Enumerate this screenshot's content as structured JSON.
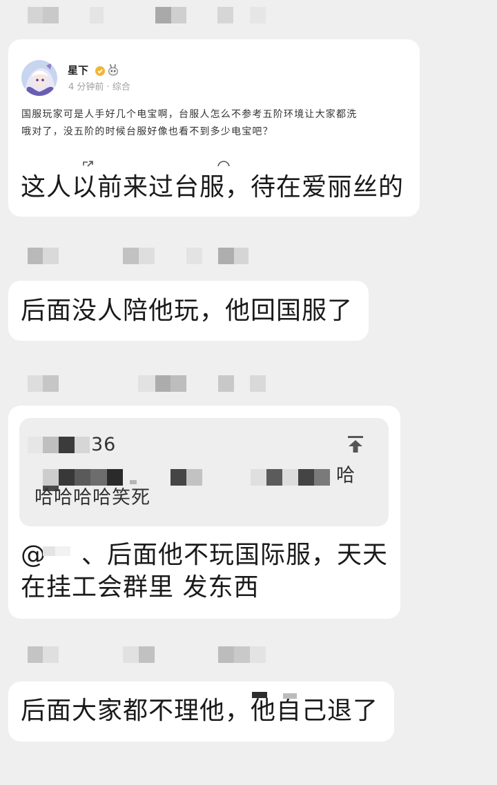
{
  "colors": {
    "background": "#efefef",
    "bubble": "#ffffff",
    "quote_background": "#eeeeee",
    "text": "#1a1a1a",
    "meta_text": "#a0a0a0",
    "badge": "#f2b632"
  },
  "messages": [
    {
      "embedded_post": {
        "author": "星下",
        "author_icons": [
          "verified-badge-icon",
          "emoji-sticker-icon"
        ],
        "meta": "4 分钟前 · 综合",
        "lines": [
          "国服玩家可是人手好几个电宝啊，台服人怎么不参考五阶环境让大家都洗",
          "哦对了，没五阶的时候台服好像也看不到多少电宝吧？"
        ],
        "action_icons": [
          "share-icon",
          "comment-icon"
        ]
      },
      "text": "这人以前来过台服，待在爱丽丝的"
    },
    {
      "text": "后面没人陪他玩，他回国服了"
    },
    {
      "quote": {
        "name_fragment": "36",
        "icon": "jump-to-original-icon",
        "line1_tail": "哈",
        "line2": "哈哈哈哈笑死"
      },
      "mention": "@",
      "text_lines": [
        "、后面他不玩国际服，天天",
        "在挂工会群里 发东西"
      ]
    },
    {
      "text": "后面大家都不理他，他自己退了"
    }
  ]
}
